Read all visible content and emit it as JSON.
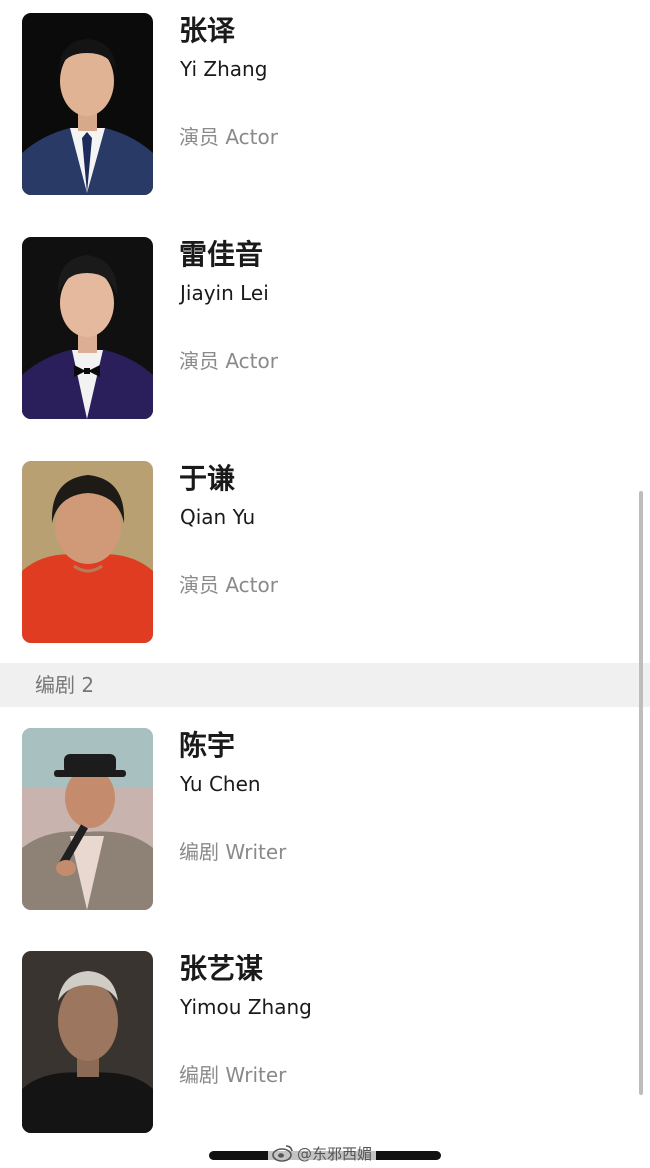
{
  "people": [
    {
      "name_cn": "张译",
      "name_en": "Yi Zhang",
      "role": "演员 Actor"
    },
    {
      "name_cn": "雷佳音",
      "name_en": "Jiayin Lei",
      "role": "演员 Actor"
    },
    {
      "name_cn": "于谦",
      "name_en": "Qian Yu",
      "role": "演员 Actor"
    },
    {
      "name_cn": "陈宇",
      "name_en": "Yu Chen",
      "role": "编剧 Writer"
    },
    {
      "name_cn": "张艺谋",
      "name_en": "Yimou Zhang",
      "role": "编剧 Writer"
    }
  ],
  "section": {
    "label": "编剧 2"
  },
  "watermark": {
    "text": "@东邪西媚",
    "icon": "weibo-icon"
  },
  "colors": {
    "text_primary": "#1a1a1a",
    "text_secondary": "#8a8a8a",
    "section_bg": "#f0f0f0"
  }
}
